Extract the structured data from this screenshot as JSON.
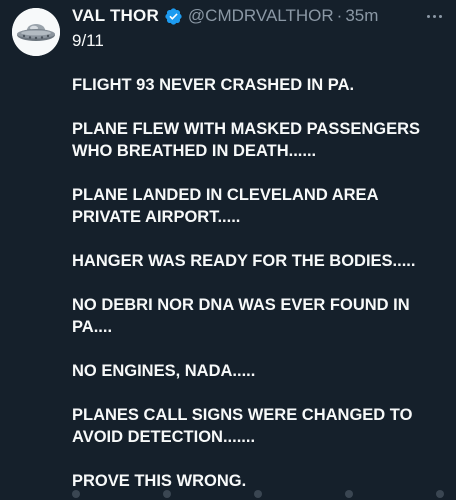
{
  "tweet": {
    "display_name": "VAL THOR",
    "handle": "@CMDRVALTHOR",
    "separator": "·",
    "time": "35m",
    "date_line": "9/11",
    "paragraphs": [
      "FLIGHT 93 NEVER CRASHED IN PA.",
      "PLANE FLEW WITH MASKED PASSENGERS\nWHO BREATHED IN DEATH......",
      "PLANE LANDED IN CLEVELAND AREA\nPRIVATE AIRPORT.....",
      "HANGER WAS READY FOR THE BODIES.....",
      "NO DEBRI NOR DNA WAS EVER FOUND IN\nPA....",
      "NO ENGINES, NADA.....",
      "PLANES CALL SIGNS WERE CHANGED TO\nAVOID DETECTION.......",
      "PROVE THIS WRONG."
    ]
  },
  "icons": {
    "avatar": "ufo-avatar-icon",
    "verified": "verified-badge-icon",
    "more": "more-options-icon"
  },
  "colors": {
    "background": "#15202b",
    "text": "#f7f9f9",
    "secondary": "#8b98a5",
    "verified": "#1d9bf0"
  }
}
